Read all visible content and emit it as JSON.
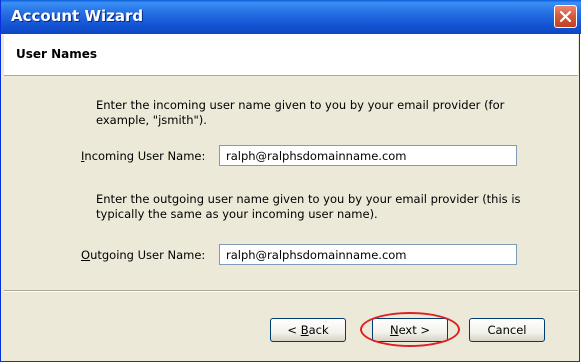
{
  "window": {
    "title": "Account Wizard",
    "close_label": "close"
  },
  "header": {
    "title": "User Names"
  },
  "incoming": {
    "instruction": "Enter the incoming user name given to you by your email provider (for example, \"jsmith\").",
    "label_accel": "I",
    "label_rest": "ncoming User Name:",
    "value": "ralph@ralphsdomainname.com"
  },
  "outgoing": {
    "instruction": "Enter the outgoing user name given to you by your email provider (this is typically the same as your incoming user name).",
    "label_accel": "O",
    "label_rest": "utgoing User Name:",
    "value": "ralph@ralphsdomainname.com"
  },
  "buttons": {
    "back_prefix": "< ",
    "back_accel": "B",
    "back_rest": "ack",
    "next_accel": "N",
    "next_rest": "ext >",
    "cancel_label": "Cancel"
  },
  "annotation": {
    "color": "#e02020",
    "target": "next-button"
  },
  "colors": {
    "titlebar": "#1556d6",
    "dialog_bg": "#ece9d8",
    "input_border": "#7f9db9"
  }
}
